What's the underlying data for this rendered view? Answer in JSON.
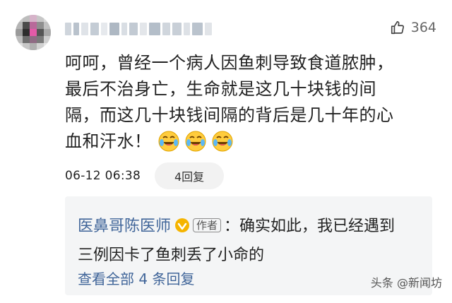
{
  "comment": {
    "like_count": "364",
    "lines": [
      "呵呵，曾经一个病人因鱼刺导致食道脓肿，",
      "最后不治身亡，生命就是这几十块钱的间",
      "隔，而这几十块钱间隔的背后是几十年的心",
      "血和汗水！"
    ],
    "emojis": [
      "crying-laugh-emoji",
      "crying-laugh-emoji",
      "crying-laugh-emoji"
    ],
    "timestamp": "06-12 06:38",
    "reply_button": "4回复"
  },
  "reply": {
    "author": "医鼻哥陈医师",
    "author_tag": "作者",
    "separator": "：",
    "text_line1": "确实如此，我已经遇到",
    "text_line2": "三例因卡了鱼刺丢了小命的",
    "view_all": "查看全部 4 条回复"
  },
  "watermark": {
    "text": "头条 @新闻坊"
  },
  "icons": {
    "like": "thumbs-up-icon",
    "verified": "verified-badge-icon"
  },
  "colors": {
    "link": "#406599",
    "verified": "#f5b400",
    "reply_background": "#f4f5f6",
    "button_background": "#f2f2f2"
  }
}
